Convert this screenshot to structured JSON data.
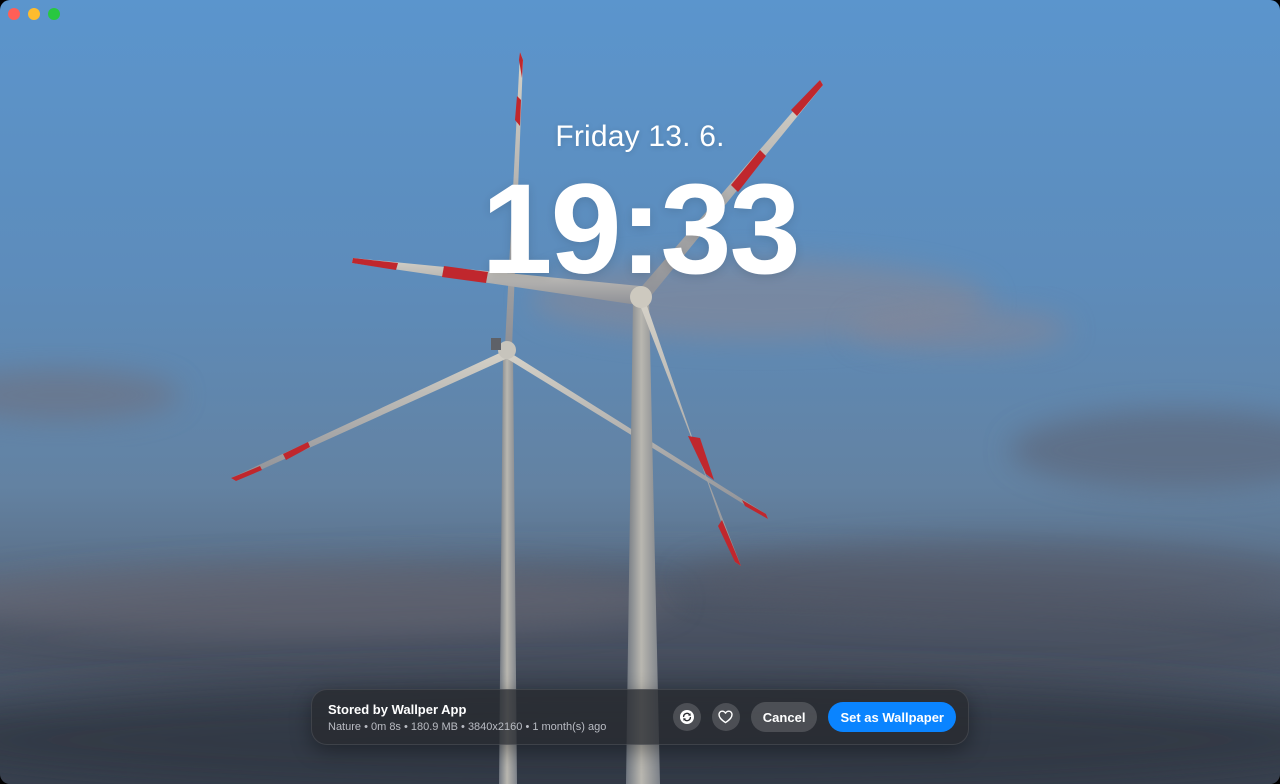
{
  "window": {
    "buttons": [
      "close",
      "minimize",
      "zoom"
    ]
  },
  "lockscreen": {
    "date": "Friday 13. 6.",
    "time": "19:33"
  },
  "preview_bar": {
    "title": "Stored by Wallper App",
    "meta": "Nature • 0m 8s • 180.9 MB • 3840x2160 • 1 month(s) ago",
    "icons": [
      "refresh-icon",
      "heart-icon"
    ],
    "cancel_label": "Cancel",
    "set_label": "Set as Wallpaper"
  },
  "colors": {
    "accent": "#0a84ff",
    "turbine_stripe": "#c0272d"
  }
}
